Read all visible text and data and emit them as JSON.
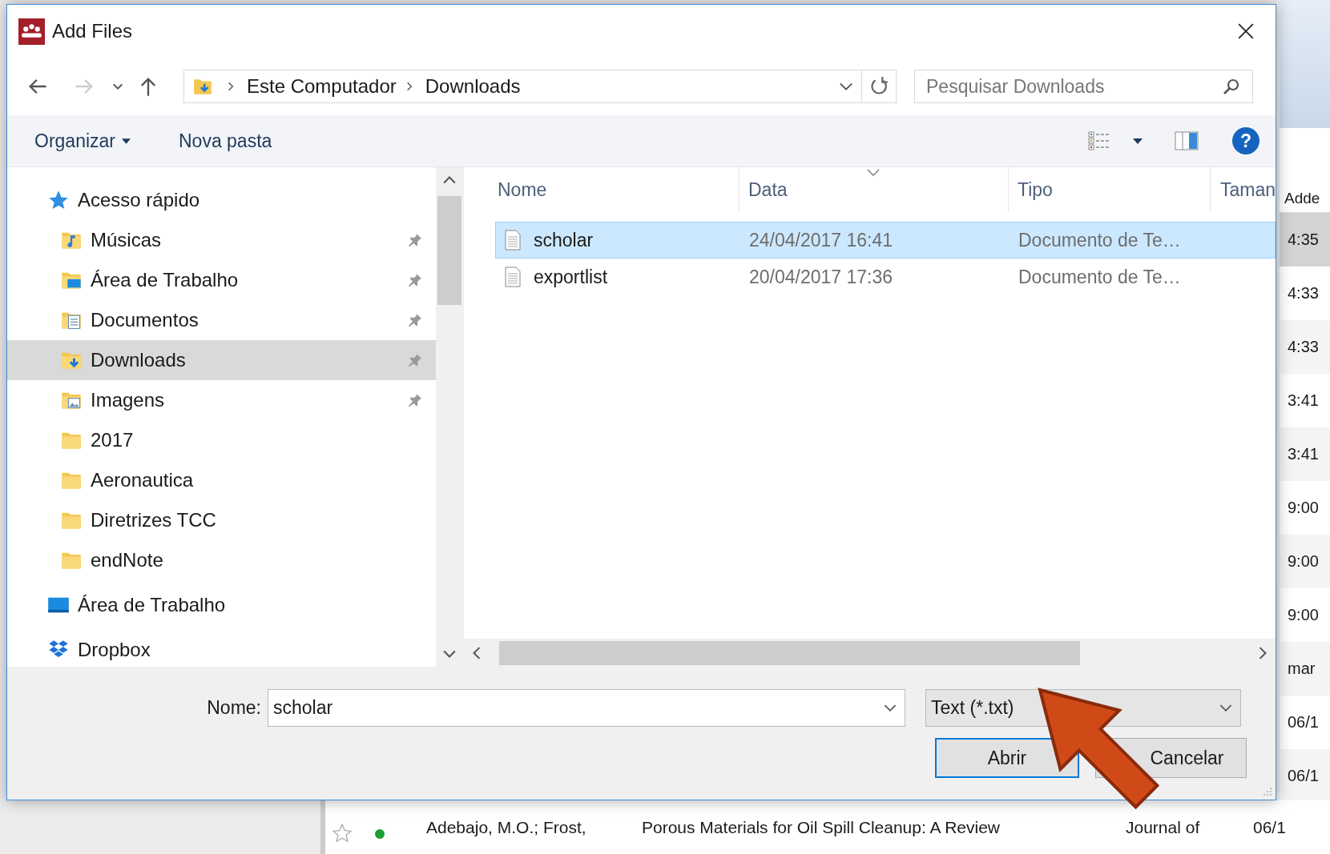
{
  "window": {
    "title": "Add Files"
  },
  "address_bar": {
    "crumbs": [
      "Este Computador",
      "Downloads"
    ]
  },
  "search": {
    "placeholder": "Pesquisar Downloads"
  },
  "toolbar": {
    "organize": "Organizar",
    "new_folder": "Nova pasta",
    "help": "?"
  },
  "sidebar": {
    "items": [
      {
        "label": "Acesso rápido",
        "kind": "quick",
        "children": [
          {
            "label": "Músicas",
            "kind": "music",
            "pinned": true,
            "selected": false
          },
          {
            "label": "Área de Trabalho",
            "kind": "desktop",
            "pinned": true,
            "selected": false
          },
          {
            "label": "Documentos",
            "kind": "documents",
            "pinned": true,
            "selected": false
          },
          {
            "label": "Downloads",
            "kind": "downloads",
            "pinned": true,
            "selected": true
          },
          {
            "label": "Imagens",
            "kind": "pictures",
            "pinned": true,
            "selected": false
          },
          {
            "label": "2017",
            "kind": "folder",
            "pinned": false,
            "selected": false
          },
          {
            "label": "Aeronautica",
            "kind": "folder",
            "pinned": false,
            "selected": false
          },
          {
            "label": "Diretrizes TCC",
            "kind": "folder",
            "pinned": false,
            "selected": false
          },
          {
            "label": "endNote",
            "kind": "folder",
            "pinned": false,
            "selected": false
          }
        ]
      },
      {
        "label": "Área de Trabalho",
        "kind": "desktop"
      },
      {
        "label": "Dropbox",
        "kind": "dropbox"
      }
    ]
  },
  "file_list": {
    "columns": [
      "Nome",
      "Data",
      "Tipo",
      "Taman"
    ],
    "rows": [
      {
        "name": "scholar",
        "date": "24/04/2017 16:41",
        "type": "Documento de Te…",
        "selected": true
      },
      {
        "name": "exportlist",
        "date": "20/04/2017 17:36",
        "type": "Documento de Te…",
        "selected": false
      }
    ]
  },
  "filename": {
    "label": "Nome:",
    "value": "scholar"
  },
  "filter": {
    "value": "Text (*.txt)"
  },
  "buttons": [
    {
      "label": "Abrir",
      "kind": "primary"
    },
    {
      "label": "Cancelar",
      "kind": "secondary"
    }
  ],
  "background_app": {
    "column_header": "Adde",
    "times": [
      {
        "text": "4:35",
        "selected": true
      },
      {
        "text": "4:33",
        "selected": false
      },
      {
        "text": "4:33",
        "selected": false
      },
      {
        "text": "3:41",
        "selected": false
      },
      {
        "text": "3:41",
        "selected": false
      },
      {
        "text": "9:00",
        "selected": false
      },
      {
        "text": "9:00",
        "selected": false
      },
      {
        "text": "9:00",
        "selected": false
      },
      {
        "text": "mar",
        "selected": false
      },
      {
        "text": "06/1",
        "selected": false
      },
      {
        "text": "06/1",
        "selected": false
      }
    ],
    "row": {
      "starred": false,
      "unread": true,
      "authors": "Adebajo, M.O.; Frost,",
      "title": "Porous Materials for Oil Spill Cleanup: A Review",
      "journal": "Journal of",
      "added": "06/1"
    }
  }
}
